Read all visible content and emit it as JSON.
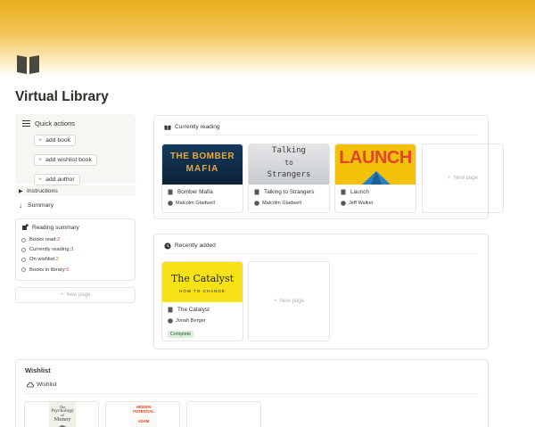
{
  "page": {
    "title": "Virtual Library",
    "icon": "book-open-icon"
  },
  "quick_actions": {
    "title": "Quick actions",
    "buttons": [
      "add book",
      "add wishlist book",
      "add author"
    ]
  },
  "instructions": {
    "label": "Instructions"
  },
  "summary": {
    "label": "Summary"
  },
  "reading_summary": {
    "title": "Reading summary",
    "lines": [
      {
        "label": "Books read: ",
        "value": "2"
      },
      {
        "label": "Currently reading: ",
        "value": "3"
      },
      {
        "label": "On wishlist: ",
        "value": "2"
      },
      {
        "label": "Books in library: ",
        "value": "5"
      }
    ]
  },
  "new_page_label": "New page",
  "currently_reading": {
    "title": "Currently reading",
    "books": [
      {
        "title": "Bomber Mafia",
        "author": "Malcolm Gladwell",
        "cover_lines": [
          "THE BOMBER",
          "MAFIA"
        ]
      },
      {
        "title": "Talking to Strangers",
        "author": "Malcolm Gladwell",
        "cover_lines": [
          "Talking",
          "to",
          "Strangers"
        ]
      },
      {
        "title": "Launch",
        "author": "Jeff Walker",
        "cover_lines": [
          "LAUNCH"
        ]
      }
    ]
  },
  "recently_added": {
    "title": "Recently added",
    "books": [
      {
        "title": "The Catalyst",
        "author": "Jonah Berger",
        "status": "Complete",
        "cover_lines": [
          "The Catalyst",
          "HOW TO CHANGE"
        ]
      }
    ]
  },
  "wishlist": {
    "title": "Wishlist",
    "tab": "Wishlist",
    "books": [
      {
        "cover_lines": [
          "The",
          "Psychology",
          "of",
          "Money"
        ]
      },
      {
        "cover_lines": [
          "HIDDEN",
          "POTENTIAL",
          "ADAM"
        ]
      }
    ]
  },
  "colors": {
    "accent_cover": "#e9ad1a",
    "status_green": "#dbeddb"
  }
}
